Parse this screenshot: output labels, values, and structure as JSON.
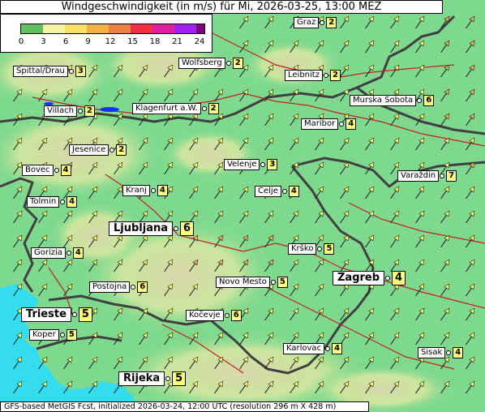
{
  "title": "Windgeschwindigkeit (in m/s) für Mi, 2026-03-25, 13:00 MEZ",
  "legend": {
    "ticks": [
      "0",
      "3",
      "6",
      "9",
      "12",
      "15",
      "18",
      "21",
      "24"
    ],
    "colors": [
      "#60c060",
      "#f4f4a0",
      "#f8e060",
      "#f4b040",
      "#f08040",
      "#f03040",
      "#e020a0",
      "#a020f0",
      "#800080"
    ]
  },
  "footer": "GFS-based MetGIS Fcst, initialized 2026-03-24, 12:00 UTC  (resolution 296 m X 428 m)",
  "colors": {
    "land": "#7ed98e",
    "sea": "#33ddee",
    "border": "#404040",
    "river": "#c02020",
    "arrow_low": "#ffff66",
    "arrow_mid": "#f0b050"
  },
  "cities": [
    {
      "id": "graz",
      "name": "Graz",
      "value": "2",
      "big": false
    },
    {
      "id": "wolfsberg",
      "name": "Wolfsberg",
      "value": "2",
      "big": false
    },
    {
      "id": "spittal",
      "name": "Spittal/Drau",
      "value": "3",
      "big": false
    },
    {
      "id": "leibnitz",
      "name": "Leibnitz",
      "value": "2",
      "big": false
    },
    {
      "id": "villach",
      "name": "Villach",
      "value": "2",
      "big": false
    },
    {
      "id": "klagenfurt",
      "name": "Klagenfurt a.W.",
      "value": "2",
      "big": false
    },
    {
      "id": "murska",
      "name": "Murska Sobota",
      "value": "6",
      "big": false
    },
    {
      "id": "maribor",
      "name": "Maribor",
      "value": "4",
      "big": false
    },
    {
      "id": "jesenice",
      "name": "Jesenice",
      "value": "2",
      "big": false
    },
    {
      "id": "bovec",
      "name": "Bovec",
      "value": "4",
      "big": false
    },
    {
      "id": "velenje",
      "name": "Velenje",
      "value": "3",
      "big": false
    },
    {
      "id": "varazdin",
      "name": "Varaždin",
      "value": "7",
      "big": false
    },
    {
      "id": "kranj",
      "name": "Kranj",
      "value": "4",
      "big": false
    },
    {
      "id": "celje",
      "name": "Celje",
      "value": "4",
      "big": false
    },
    {
      "id": "tolmin",
      "name": "Tolmin",
      "value": "4",
      "big": false
    },
    {
      "id": "ljubljana",
      "name": "Ljubljana",
      "value": "6",
      "big": true
    },
    {
      "id": "gorizia",
      "name": "Gorizia",
      "value": "4",
      "big": false
    },
    {
      "id": "krsko",
      "name": "Krško",
      "value": "5",
      "big": false
    },
    {
      "id": "postojna",
      "name": "Postojna",
      "value": "6",
      "big": false
    },
    {
      "id": "novomesto",
      "name": "Novo Mesto",
      "value": "5",
      "big": false
    },
    {
      "id": "zagreb",
      "name": "Zagreb",
      "value": "4",
      "big": true
    },
    {
      "id": "trieste",
      "name": "Trieste",
      "value": "5",
      "big": true
    },
    {
      "id": "kocevje",
      "name": "Kočevje",
      "value": "6",
      "big": false
    },
    {
      "id": "koper",
      "name": "Koper",
      "value": "5",
      "big": false
    },
    {
      "id": "karlovac",
      "name": "Karlovac",
      "value": "4",
      "big": false
    },
    {
      "id": "sisak",
      "name": "Sisak",
      "value": "4",
      "big": false
    },
    {
      "id": "rijeka",
      "name": "Rijeka",
      "value": "5",
      "big": true
    }
  ]
}
